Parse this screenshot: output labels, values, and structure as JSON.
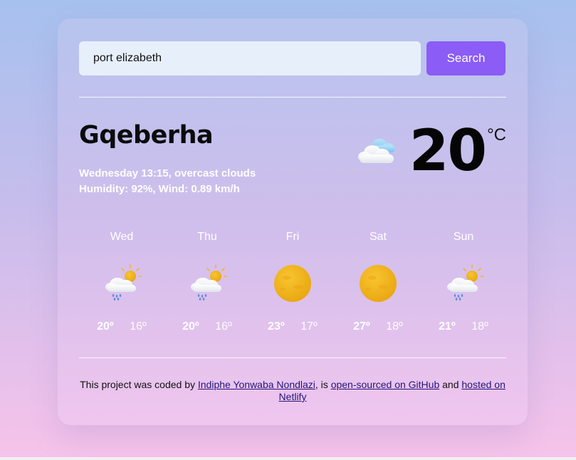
{
  "search": {
    "value": "port elizabeth",
    "button_label": "Search"
  },
  "current": {
    "city": "Gqeberha",
    "date_line": "Wednesday 13:15, overcast clouds",
    "humidity_line": "Humidity: 92%, Wind: 0.89 km/h",
    "temperature": "20",
    "unit": "°C",
    "icon": "overcast-clouds-icon"
  },
  "forecast": [
    {
      "day": "Wed",
      "max": "20º",
      "min": "16º",
      "icon": "rain-sun-icon"
    },
    {
      "day": "Thu",
      "max": "20º",
      "min": "16º",
      "icon": "rain-sun-icon"
    },
    {
      "day": "Fri",
      "max": "23º",
      "min": "17º",
      "icon": "sun-icon"
    },
    {
      "day": "Sat",
      "max": "27º",
      "min": "18º",
      "icon": "sun-icon"
    },
    {
      "day": "Sun",
      "max": "21º",
      "min": "18º",
      "icon": "rain-sun-icon"
    }
  ],
  "footer": {
    "prefix": "This project was coded by ",
    "author_link": "Indiphe Yonwaba Nondlazi",
    "mid1": ", is ",
    "github_link": "open-sourced on GitHub",
    "mid2": " and ",
    "netlify_link": "hosted on Netlify"
  },
  "colors": {
    "accent": "#8b5cf6",
    "input_bg": "#e7effb"
  }
}
